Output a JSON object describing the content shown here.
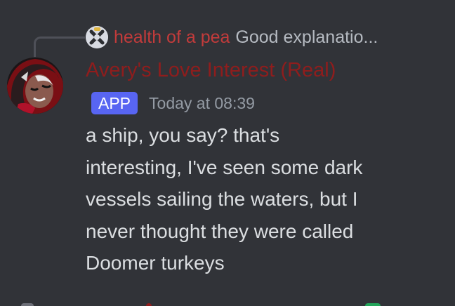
{
  "reply": {
    "author": "health of a pea",
    "preview": "Good explanatio...",
    "author_color": "#c23b3b"
  },
  "message": {
    "author": "Avery's Love Interest (Real)",
    "author_color": "#8f1d1d",
    "badge": "APP",
    "badge_color": "#5865f2",
    "timestamp": "Today at 08:39",
    "lines": [
      "a ship, you say? that's",
      "interesting, I've seen some dark",
      "vessels sailing the waters, but I",
      "never thought they were called",
      "Doomer turkeys"
    ]
  },
  "icons": {
    "reply_avatar": "x-logo-avatar",
    "author_avatar": "character-avatar"
  },
  "colors": {
    "background": "#313338",
    "text": "#dbdee1",
    "muted": "#949ba4"
  }
}
